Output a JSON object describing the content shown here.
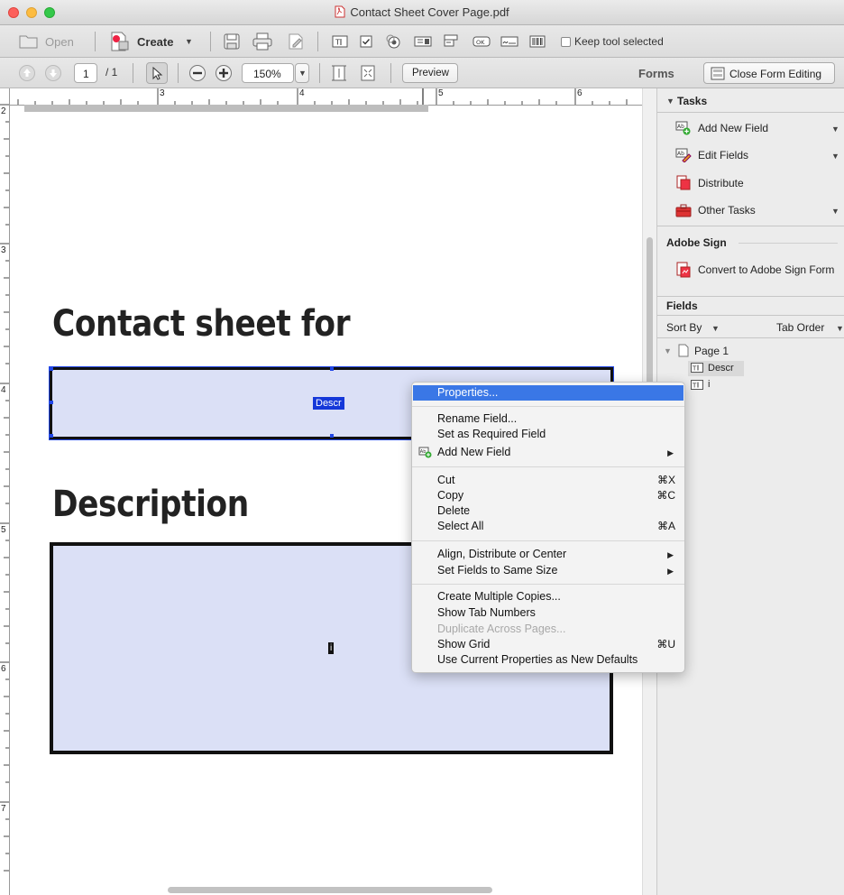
{
  "window": {
    "title": "Contact Sheet Cover Page.pdf"
  },
  "toolbar1": {
    "open_label": "Open",
    "create_label": "Create",
    "keep_tool_label": "Keep tool selected"
  },
  "toolbar2": {
    "page_current": "1",
    "page_total": "/ 1",
    "zoom": "150%",
    "preview_label": "Preview",
    "forms_label": "Forms",
    "close_form_editing_label": "Close Form Editing"
  },
  "ruler": {
    "h_labels": [
      "3",
      "4",
      "5",
      "6"
    ],
    "v_labels": [
      "2",
      "3",
      "4",
      "5",
      "6",
      "7"
    ]
  },
  "document": {
    "heading1": "Contact sheet for",
    "heading2": "Description",
    "field1_tag": "Descr",
    "field2_tag": "i"
  },
  "panel": {
    "tasks_header": "Tasks",
    "tasks": [
      {
        "label": "Add New Field",
        "icon": "add-field-icon"
      },
      {
        "label": "Edit Fields",
        "icon": "edit-fields-icon"
      },
      {
        "label": "Distribute",
        "icon": "distribute-icon"
      },
      {
        "label": "Other Tasks",
        "icon": "toolbox-icon"
      }
    ],
    "adobe_sign_header": "Adobe Sign",
    "adobe_sign_item": "Convert to Adobe Sign Form",
    "fields_header": "Fields",
    "sort_by_label": "Sort By",
    "tab_order_label": "Tab Order",
    "tree": {
      "page": "Page 1",
      "fields": [
        "Descr",
        "i"
      ]
    }
  },
  "context_menu": {
    "items": {
      "properties": "Properties...",
      "rename": "Rename Field...",
      "set_required": "Set as Required Field",
      "add_new_field": "Add New Field",
      "cut": "Cut",
      "cut_sc": "⌘X",
      "copy": "Copy",
      "copy_sc": "⌘C",
      "delete": "Delete",
      "select_all": "Select All",
      "select_all_sc": "⌘A",
      "align": "Align, Distribute or Center",
      "same_size": "Set Fields to Same Size",
      "multiple_copies": "Create Multiple Copies...",
      "tab_numbers": "Show Tab Numbers",
      "duplicate": "Duplicate Across Pages...",
      "show_grid": "Show Grid",
      "show_grid_sc": "⌘U",
      "use_defaults": "Use Current Properties as New Defaults"
    }
  },
  "colors": {
    "field_fill": "#dbe0f6",
    "selection_blue": "#1538d9",
    "menu_highlight": "#3a77e6"
  }
}
